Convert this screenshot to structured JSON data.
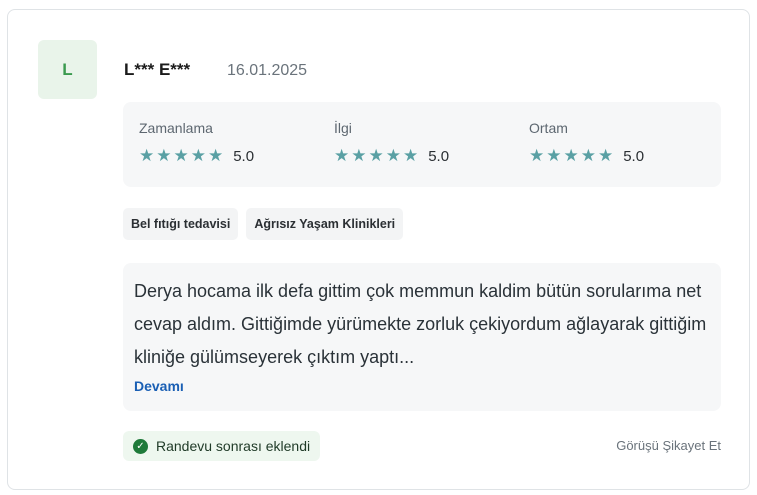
{
  "review": {
    "avatar_letter": "L",
    "author": "L*** E***",
    "date": "16.01.2025",
    "ratings": [
      {
        "label": "Zamanlama",
        "stars": "★★★★★",
        "score": "5.0"
      },
      {
        "label": "İlgi",
        "stars": "★★★★★",
        "score": "5.0"
      },
      {
        "label": "Ortam",
        "stars": "★★★★★",
        "score": "5.0"
      }
    ],
    "tags": [
      "Bel fıtığı tedavisi",
      "Ağrısız Yaşam Klinikleri"
    ],
    "text": "Derya hocama ilk defa gittim çok memmun kaldim bütün sorularıma net cevap aldım. Gittiğimde yürümekte zorluk çekiyordum ağlayarak gittiğim kliniğe gülümseyerek çıktım yaptı...",
    "more_label": "Devamı",
    "badge_label": "Randevu sonrası eklendi",
    "report_label": "Görüşü Şikayet Et"
  },
  "colors": {
    "star": "#5aa0a4",
    "avatar_bg": "#e9f4ea",
    "avatar_text": "#3a9a4e",
    "link": "#1a5fb4",
    "badge_check": "#1f7a3a"
  },
  "icons": {
    "badge": "check-circle-icon",
    "stars": "star-icon"
  }
}
